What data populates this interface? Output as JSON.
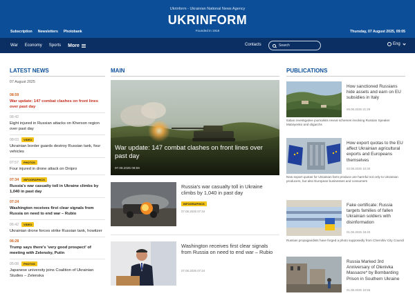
{
  "header": {
    "agency": "Ukrinform - Ukrainian National News Agency",
    "logo": "UKRINFORM",
    "founded": "Founded in 1918",
    "links": [
      "Subscription",
      "Newsletters",
      "Photobank"
    ],
    "date": "Thursday, 07 August 2025, 09:05"
  },
  "nav": {
    "items": [
      "War",
      "Economy",
      "Sports"
    ],
    "more": "More",
    "contacts": "Contacts",
    "search_placeholder": "Search",
    "lang": "Eng"
  },
  "sections": {
    "latest": "LATEST NEWS",
    "main": "MAIN",
    "publications": "PUBLICATIONS"
  },
  "latest": {
    "date": "07 August 2025",
    "items": [
      {
        "time": "08:59",
        "title": "War update: 147 combat clashes on front lines over past day",
        "badge": ""
      },
      {
        "time": "08:42",
        "title": "Eight injured in Russian attacks on Kherson region over past day",
        "badge": ""
      },
      {
        "time": "08:03",
        "title": "Ukrainian border guards destroy Russian tank, four vehicles",
        "badge": "VIDEO"
      },
      {
        "time": "07:57",
        "title": "Four injured in drone attack on Dnipro",
        "badge": "PHOTOS"
      },
      {
        "time": "07:34",
        "title": "Russia's war casualty toll in Ukraine climbs by 1,040 in past day",
        "badge": "INFOGRAPHICS"
      },
      {
        "time": "07:24",
        "title": "Washington receives first clear signals from Russia on need to end war – Rubio",
        "badge": ""
      },
      {
        "time": "06:42",
        "title": "Ukrainian drone forces strike Russian tank, howitzer",
        "badge": "VIDEO"
      },
      {
        "time": "06:28",
        "title": "Trump says there's 'very good prospect' of meeting with Zelensky, Putin",
        "badge": ""
      },
      {
        "time": "05:08",
        "title": "Japanese university joins Coalition of Ukrainian Studies – Zelenska",
        "badge": "PHOTOS"
      }
    ]
  },
  "main": {
    "hero": {
      "title": "War update: 147 combat clashes on front lines over past day",
      "date": "07.08.2025 08:59"
    },
    "stories": [
      {
        "title": "Russia's war casualty toll in Ukraine climbs by 1,040 in past day",
        "badge": "INFOGRAPHICS",
        "date": "07.08.2025 07:34"
      },
      {
        "title": "Washington receives first clear signals from Russia on need to end war – Rubio",
        "badge": "",
        "date": "07.08.2025 07:24"
      }
    ]
  },
  "publications": [
    {
      "title": "How sanctioned Russians hide assets and earn on EU subsidies in Italy",
      "date": "06.08.2025 21:29",
      "caption": "Italian investigative journalists reveal schemes involving Russian Speaker Matviyenko and oligarchs"
    },
    {
      "title": "How export quotas to the EU affect Ukrainian agricultural exports and Europeans themselves",
      "date": "02.08.2025 10:30",
      "caption": "New export quotas for Ukrainian farm produce are harmful not only to Ukrainian producers, but also European businesses and consumers"
    },
    {
      "title": "Fake certificate: Russia targets families of fallen Ukrainian soldiers with disinformation",
      "date": "01.08.2025 18:40",
      "caption": "Russian propagandists have forged a photo supposedly from Chernihiv City Council"
    },
    {
      "title": "Russia Marked 3rd Anniversary of Olenivka Massacre* by Bombarding Prison in Southern Ukraine",
      "date": "01.08.2025 10:55",
      "caption": ""
    }
  ],
  "colors": {
    "header_blue": "#0c4f98",
    "nav_navy": "#0b2f63",
    "accent_red": "#c42d1b",
    "time_orange": "#d0611c",
    "badge_yellow": "#f4c518"
  }
}
